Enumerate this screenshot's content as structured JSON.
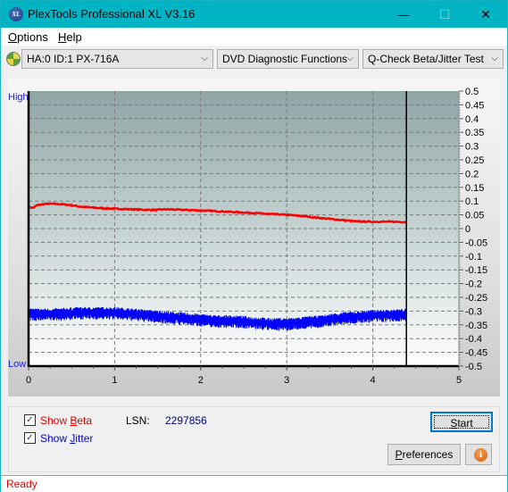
{
  "window": {
    "title": "PlexTools Professional XL V3.16",
    "app_icon_text": "XL",
    "minimize_glyph": "—",
    "maximize_glyph": "☐",
    "close_glyph": "✕"
  },
  "menu": {
    "items": [
      {
        "label": "Options",
        "accel": "O",
        "rest": "ptions"
      },
      {
        "label": "Help",
        "accel": "H",
        "rest": "elp"
      }
    ]
  },
  "toolbar": {
    "drive": "HA:0 ID:1  PX-716A",
    "function": "DVD Diagnostic Functions",
    "test": "Q-Check Beta/Jitter Test",
    "chevron": "⌵"
  },
  "chart_data": {
    "type": "line",
    "title": "",
    "xlabel": "",
    "ylabel": "",
    "left_axis_labels": {
      "high": "High",
      "low": "Low"
    },
    "xlim": [
      0,
      5
    ],
    "ylim": [
      -0.5,
      0.5
    ],
    "x_ticks": [
      0,
      1,
      2,
      3,
      4,
      5
    ],
    "y_ticks": [
      0.5,
      0.45,
      0.4,
      0.35,
      0.3,
      0.25,
      0.2,
      0.15,
      0.1,
      0.05,
      0,
      -0.05,
      -0.1,
      -0.15,
      -0.2,
      -0.25,
      -0.3,
      -0.35,
      -0.4,
      -0.45,
      -0.5
    ],
    "grid": true,
    "end_marker_x": 4.39,
    "series": [
      {
        "name": "Beta",
        "color": "#ff0000",
        "x": [
          0,
          0.05,
          0.1,
          0.2,
          0.3,
          0.4,
          0.5,
          0.6,
          0.8,
          1.0,
          1.2,
          1.4,
          1.5,
          1.6,
          1.8,
          2.0,
          2.2,
          2.4,
          2.6,
          2.8,
          3.0,
          3.2,
          3.4,
          3.6,
          3.8,
          4.0,
          4.2,
          4.39
        ],
        "y": [
          0.08,
          0.075,
          0.085,
          0.09,
          0.09,
          0.088,
          0.085,
          0.08,
          0.075,
          0.072,
          0.07,
          0.068,
          0.068,
          0.07,
          0.068,
          0.066,
          0.063,
          0.06,
          0.057,
          0.053,
          0.05,
          0.045,
          0.038,
          0.032,
          0.026,
          0.025,
          0.025,
          0.024
        ]
      },
      {
        "name": "Jitter",
        "color": "#0000ff",
        "x": [
          0,
          0.3,
          0.6,
          0.8,
          1.0,
          1.2,
          1.4,
          1.6,
          1.8,
          2.0,
          2.2,
          2.4,
          2.6,
          2.8,
          3.0,
          3.2,
          3.4,
          3.6,
          3.8,
          4.0,
          4.2,
          4.39
        ],
        "y": [
          -0.31,
          -0.31,
          -0.305,
          -0.305,
          -0.305,
          -0.31,
          -0.315,
          -0.32,
          -0.325,
          -0.33,
          -0.335,
          -0.335,
          -0.34,
          -0.345,
          -0.345,
          -0.34,
          -0.335,
          -0.325,
          -0.32,
          -0.315,
          -0.315,
          -0.31
        ],
        "noise": 0.02
      }
    ]
  },
  "options": {
    "show_beta": {
      "label_pre": "Show ",
      "accel": "B",
      "label_post": "eta",
      "checked": true,
      "color": "#e00000"
    },
    "show_jitter": {
      "label_pre": "Show ",
      "accel": "J",
      "label_post": "itter",
      "checked": true,
      "color": "#0000e0"
    },
    "lsn_label": "LSN:",
    "lsn_value": "2297856",
    "check_glyph": "✓"
  },
  "buttons": {
    "start": {
      "accel": "S",
      "rest": "tart"
    },
    "preferences": {
      "accel": "P",
      "rest": "references"
    },
    "info_glyph": "i"
  },
  "status": {
    "text": "Ready"
  }
}
